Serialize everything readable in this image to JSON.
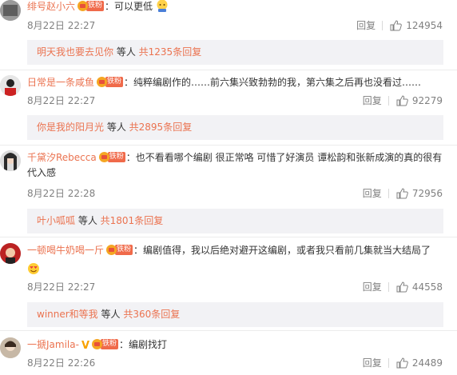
{
  "like_icon": "thumbs-up-icon",
  "reply_label": "回复",
  "comments": [
    {
      "username": "绯号赵小六",
      "fan_tag": "铁粉",
      "text": "：可以更低",
      "emoji": "blushing-face-emoji",
      "date": "8月22日 22:27",
      "likes": "124954",
      "sub_name": "明天我也要去见你",
      "sub_mid": " 等人 ",
      "sub_count": "共1235条回复"
    },
    {
      "username": "日常是一条咸鱼",
      "fan_tag": "铁粉",
      "text": "：纯粹编剧作的……前六集兴致勃勃的我，第六集之后再也没看过……",
      "date": "8月22日 22:27",
      "likes": "92279",
      "sub_name": "你是我的阳月光",
      "sub_mid": " 等人 ",
      "sub_count": "共2895条回复"
    },
    {
      "username": "千黛汐Rebecca",
      "fan_tag": "铁粉",
      "text": "：也不看看哪个编剧 很正常咯 可惜了好演员 谭松韵和张新成演的真的很有代入感",
      "date": "8月22日 22:28",
      "likes": "72956",
      "sub_name": "叶小呱呱",
      "sub_mid": " 等人 ",
      "sub_count": "共1801条回复"
    },
    {
      "username": "一顿喝牛奶喝一斤",
      "fan_tag": "铁粉",
      "text": "：编剧值得，我以后绝对避开这编剧，或者我只看前几集就当大结局了",
      "emoji": "heart-eyes-emoji",
      "date": "8月22日 22:27",
      "likes": "44558",
      "sub_name": "winner和等我",
      "sub_mid": " 等人 ",
      "sub_count": "共360条回复"
    },
    {
      "username": "一搋Jamila-",
      "verified": "V",
      "fan_tag": "铁粉",
      "text": "：编剧找打",
      "date": "8月22日 22:26",
      "likes": "24489"
    }
  ]
}
